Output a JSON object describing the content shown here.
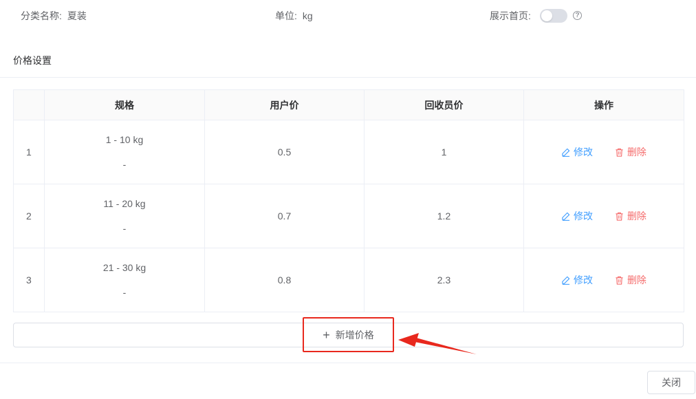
{
  "info": {
    "category_label": "分类名称:",
    "category_value": "夏装",
    "unit_label": "单位:",
    "unit_value": "kg",
    "homepage_label": "展示首页:",
    "homepage_toggle_on": false,
    "help_glyph": "?"
  },
  "section": {
    "title": "价格设置"
  },
  "table": {
    "headers": [
      "",
      "规格",
      "用户价",
      "回收员价",
      "操作"
    ],
    "rows": [
      {
        "index": "1",
        "spec": "1 - 10 kg",
        "spec_sub": "-",
        "user_price": "0.5",
        "collector_price": "1"
      },
      {
        "index": "2",
        "spec": "11 - 20 kg",
        "spec_sub": "-",
        "user_price": "0.7",
        "collector_price": "1.2"
      },
      {
        "index": "3",
        "spec": "21 - 30 kg",
        "spec_sub": "-",
        "user_price": "0.8",
        "collector_price": "2.3"
      }
    ],
    "edit_label": "修改",
    "delete_label": "删除"
  },
  "add_button": {
    "icon": "plus-icon",
    "label": "新增价格"
  },
  "footer": {
    "close_label": "关闭"
  },
  "colors": {
    "primary": "#409eff",
    "danger": "#f56c6c",
    "annotation": "#e8281d"
  }
}
